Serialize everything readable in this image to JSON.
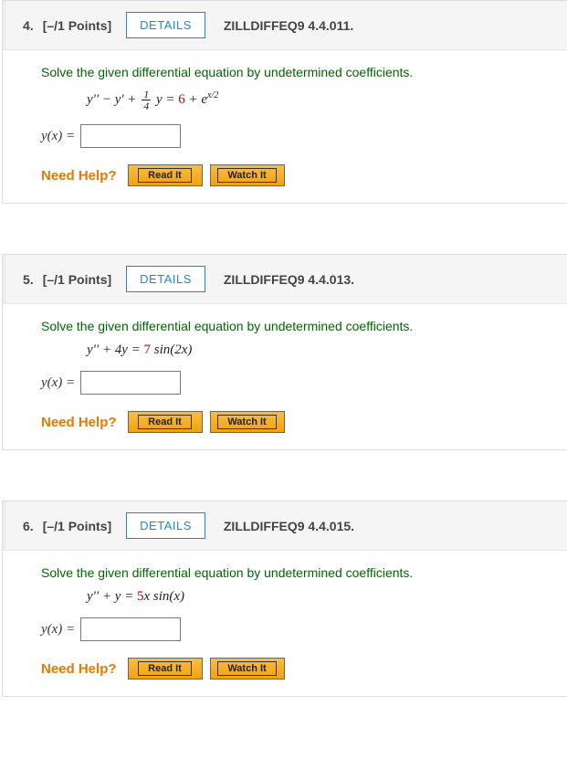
{
  "common": {
    "details_label": "DETAILS",
    "instruction": "Solve the given differential equation by undetermined coefficients.",
    "need_help_label": "Need Help?",
    "read_it_label": "Read It",
    "watch_it_label": "Watch It",
    "answer_prefix": "y(x) ="
  },
  "questions": [
    {
      "number": "4.",
      "points": "[–/1 Points]",
      "code": "ZILLDIFFEQ9 4.4.011.",
      "equation_type": "frac",
      "eq_left1": "y'' − y' + ",
      "frac_num": "1",
      "frac_den": "4",
      "eq_left2": "y = ",
      "coeff": "6",
      "eq_right": " + e",
      "exp": "x/2"
    },
    {
      "number": "5.",
      "points": "[–/1 Points]",
      "code": "ZILLDIFFEQ9 4.4.013.",
      "equation_type": "plain",
      "eq_before": "y'' + 4y = ",
      "coeff": "7",
      "eq_after": " sin(2x)"
    },
    {
      "number": "6.",
      "points": "[–/1 Points]",
      "code": "ZILLDIFFEQ9 4.4.015.",
      "equation_type": "plain",
      "eq_before": "y'' + y = ",
      "coeff": "5",
      "eq_after": "x sin(x)"
    }
  ]
}
